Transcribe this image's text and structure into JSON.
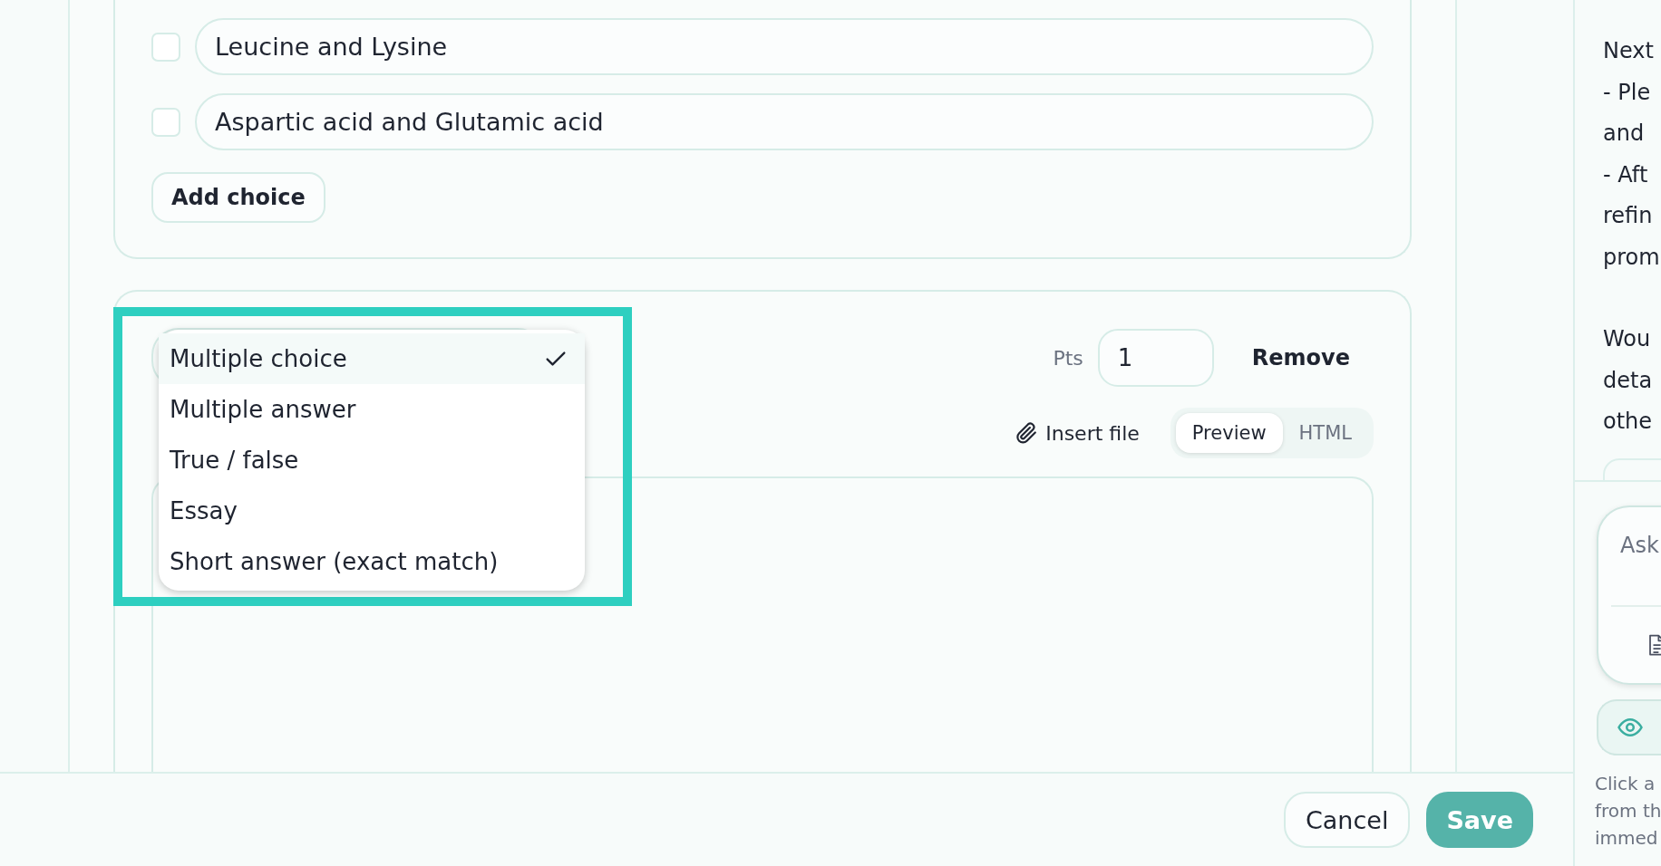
{
  "choices": [
    {
      "text": "Leucine and Lysine",
      "checked": false
    },
    {
      "text": "Aspartic acid and Glutamic acid",
      "checked": false
    }
  ],
  "add_choice_button": "Add choice",
  "question": {
    "points_label": "Pts",
    "points_value": "1",
    "remove_button": "Remove",
    "insert_file_button": "Insert file",
    "view_tabs": [
      {
        "label": "Preview",
        "selected": true
      },
      {
        "label": "HTML",
        "selected": false
      }
    ],
    "type_menu": [
      {
        "label": "Multiple choice",
        "selected": true
      },
      {
        "label": "Multiple answer",
        "selected": false
      },
      {
        "label": "True / false",
        "selected": false
      },
      {
        "label": "Essay",
        "selected": false
      },
      {
        "label": "Short answer (exact match)",
        "selected": false
      }
    ]
  },
  "footer": {
    "buttons": [
      {
        "label": "Cancel",
        "kind": "secondary"
      },
      {
        "label": "Save",
        "kind": "primary"
      }
    ]
  },
  "assistant": {
    "paragraphs": [
      [
        "Next",
        "- Ple",
        "and",
        "- Aft",
        "refin",
        "prom"
      ],
      [
        "Wou",
        "deta",
        "othe"
      ]
    ],
    "chat_input": {
      "placeholder": "Ask"
    },
    "hint_lines": [
      "Click a",
      "from th",
      "immed"
    ]
  }
}
